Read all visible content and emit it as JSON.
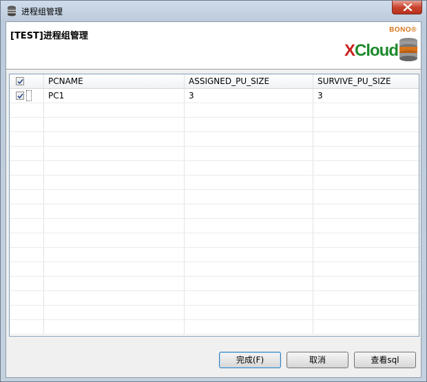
{
  "window": {
    "title": "进程组管理"
  },
  "header": {
    "title": "[TEST]进程组管理",
    "logo": {
      "brand_top": "BONO®",
      "x_letter": "X",
      "brand_rest": "Cloud"
    }
  },
  "table": {
    "header_checked": true,
    "columns": [
      "PCNAME",
      "ASSIGNED_PU_SIZE",
      "SURVIVE_PU_SIZE"
    ],
    "rows": [
      {
        "checked": true,
        "cells": [
          "PC1",
          "3",
          "3"
        ]
      }
    ],
    "empty_row_count": 16
  },
  "buttons": {
    "finish": "完成(F)",
    "cancel": "取消",
    "view_sql": "查看sql"
  },
  "colors": {
    "logo_red": "#c8201c",
    "logo_green": "#1c8a2c",
    "logo_orange": "#d9741c",
    "close_button": "#c9442f"
  },
  "icons": {
    "title": "database-icon",
    "close": "close-icon",
    "logo": "database-stack-icon"
  }
}
